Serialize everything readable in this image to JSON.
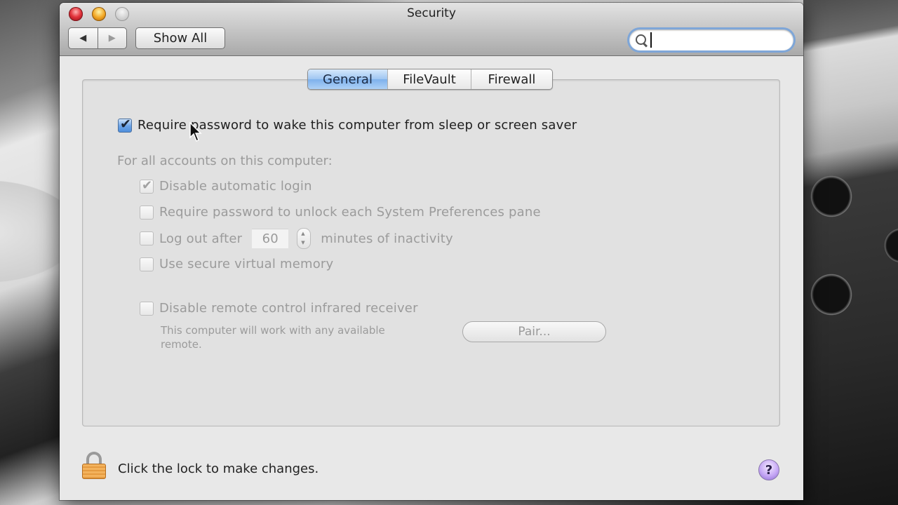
{
  "window": {
    "title": "Security"
  },
  "toolbar": {
    "back_icon": "back-arrow-icon",
    "forward_icon": "forward-arrow-icon",
    "back_glyph": "◀",
    "forward_glyph": "▶",
    "show_all_label": "Show All",
    "search": {
      "value": "",
      "placeholder": "",
      "icon": "search-icon",
      "focused": true
    }
  },
  "tabs": [
    {
      "label": "General",
      "selected": true
    },
    {
      "label": "FileVault",
      "selected": false
    },
    {
      "label": "Firewall",
      "selected": false
    }
  ],
  "general": {
    "require_password_wake": {
      "label": "Require password to wake this computer from sleep or screen saver",
      "checked": true,
      "enabled": true
    },
    "all_accounts_label": "For all accounts on this computer:",
    "options": [
      {
        "label": "Disable automatic login",
        "checked": true,
        "enabled": false
      },
      {
        "label": "Require password to unlock each System Preferences pane",
        "checked": false,
        "enabled": false
      },
      {
        "label": "Log out after",
        "checked": false,
        "enabled": false,
        "minutes_value": "60",
        "suffix": "minutes of inactivity"
      },
      {
        "label": "Use secure virtual memory",
        "checked": false,
        "enabled": false
      }
    ],
    "remote": {
      "label": "Disable remote control infrared receiver",
      "checked": false,
      "enabled": false,
      "help_text": "This computer will work with any available remote.",
      "pair_button_label": "Pair..."
    }
  },
  "footer": {
    "lock_icon": "lock-icon",
    "lock_text": "Click the lock to make changes.",
    "help_glyph": "?"
  },
  "colors": {
    "selected_tab": "#7eb1ec",
    "checkbox_active": "#4f8fdc",
    "search_focus_ring": "#7ea6d8",
    "lock_orange": "#e59a3f",
    "help_purple": "#c6a8f5"
  }
}
